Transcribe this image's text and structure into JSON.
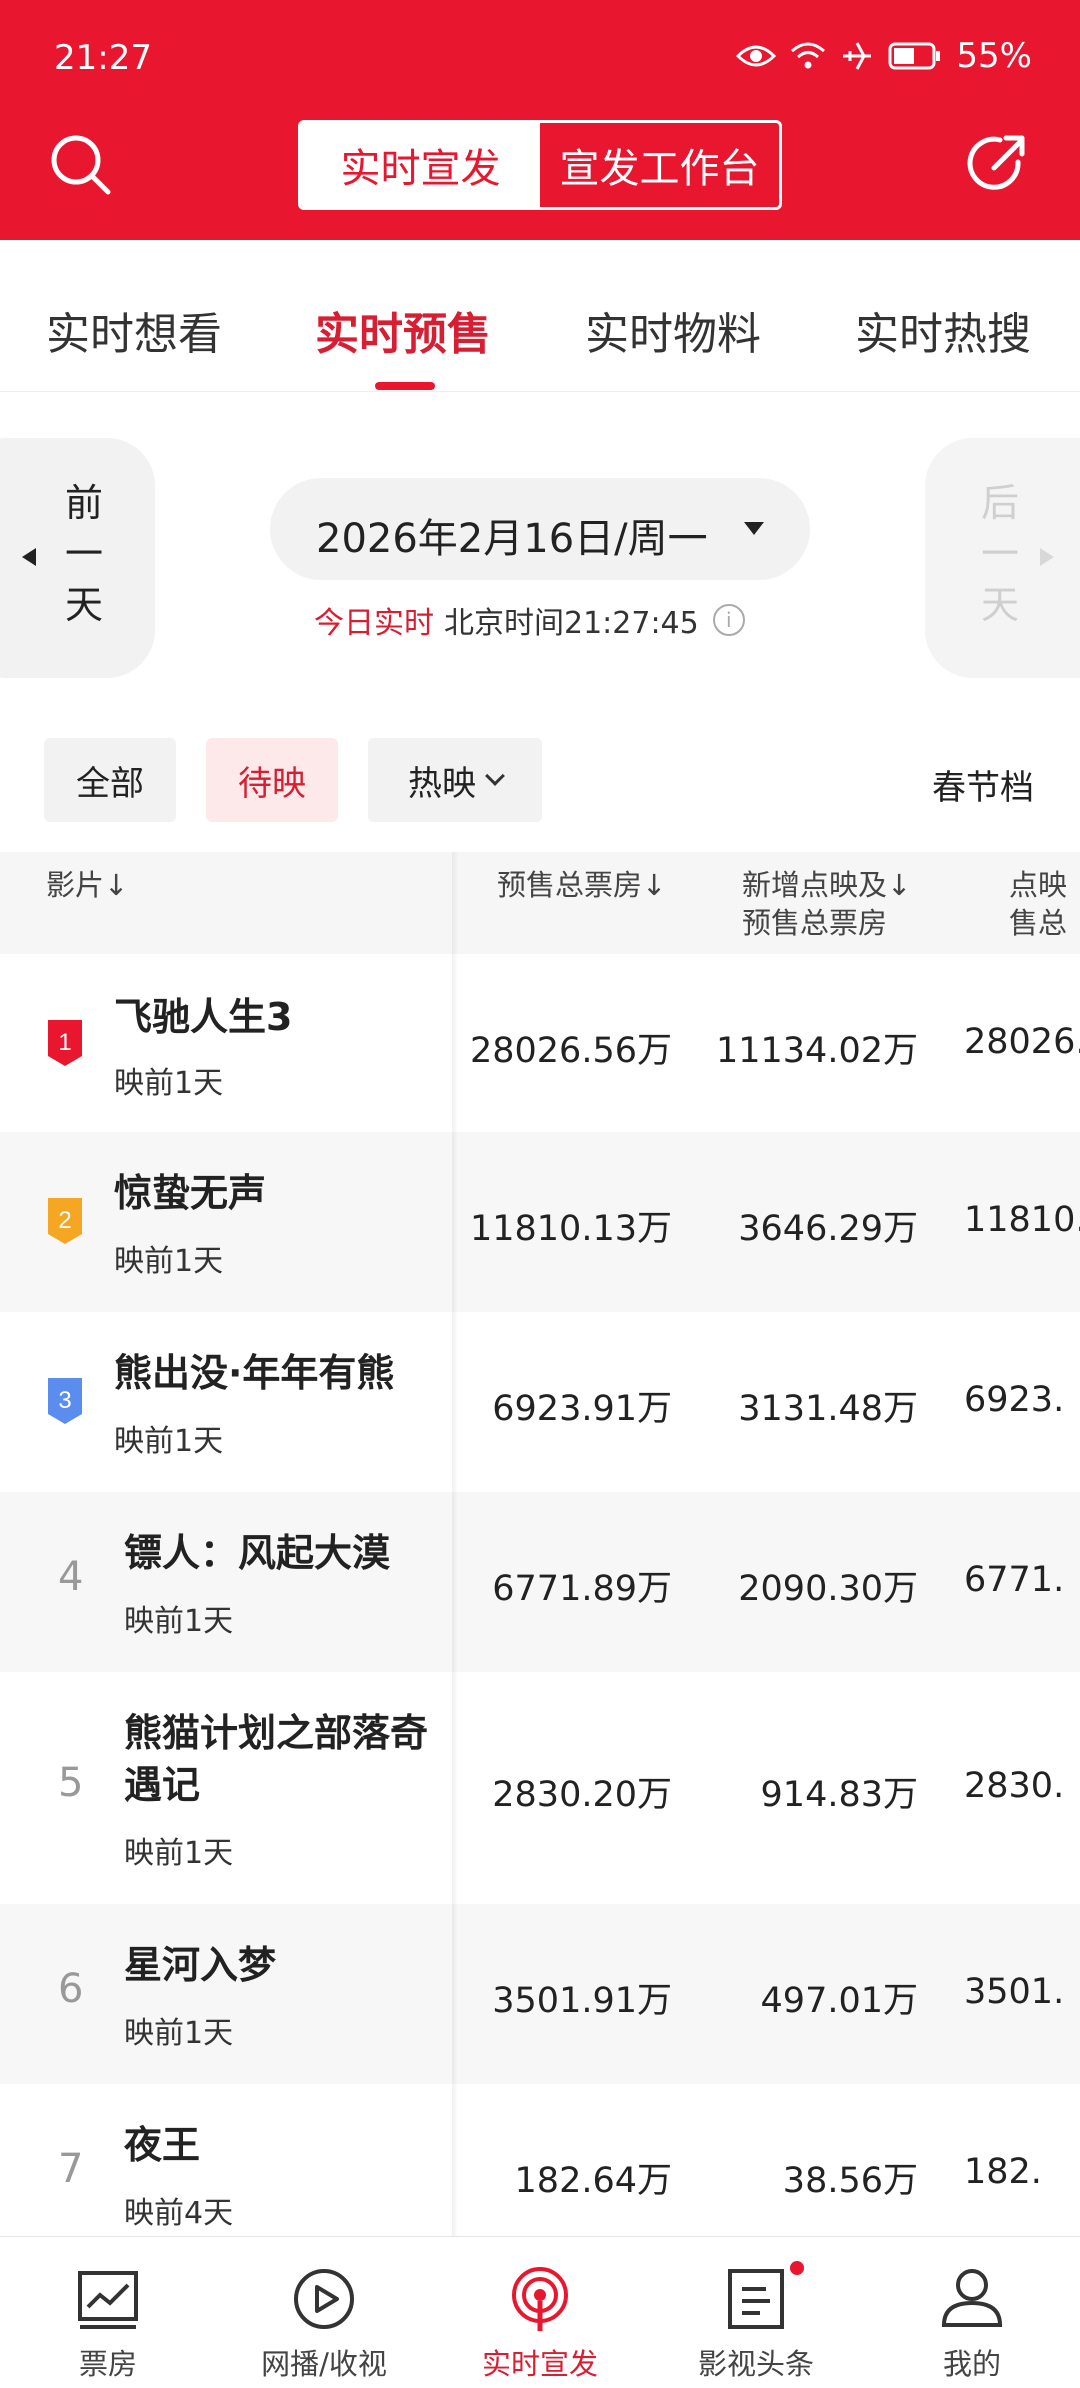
{
  "status_bar": {
    "time": "21:27",
    "battery": "55%"
  },
  "header": {
    "segments": [
      "实时宣发",
      "宣发工作台"
    ],
    "colors": {
      "brand_red": "#e8162f"
    }
  },
  "tabs": [
    "实时想看",
    "实时预售",
    "实时物料",
    "实时热搜"
  ],
  "date_nav": {
    "prev_label": "前一天",
    "next_label": "后一天",
    "date": "2026年2月16日/周一",
    "today_label": "今日实时",
    "beijing_time": "北京时间21:27:45"
  },
  "filters": {
    "all": "全部",
    "upcoming": "待映",
    "showing": "热映",
    "spring": "春节档"
  },
  "table": {
    "headers": {
      "film": "影片↓",
      "presale_total": "预售总票房↓",
      "new_line1": "新增点映及↓",
      "new_line2": "预售总票房",
      "col3_line1": "点映",
      "col3_line2": "售总"
    },
    "rows": [
      {
        "rank": "1",
        "title": "飞驰人生3",
        "status": "映前1天",
        "presale": "28026.56万",
        "new": "11134.02万",
        "col3": "28026."
      },
      {
        "rank": "2",
        "title": "惊蛰无声",
        "status": "映前1天",
        "presale": "11810.13万",
        "new": "3646.29万",
        "col3": "11810."
      },
      {
        "rank": "3",
        "title": "熊出没·年年有熊",
        "status": "映前1天",
        "presale": "6923.91万",
        "new": "3131.48万",
        "col3": "6923."
      },
      {
        "rank": "4",
        "title": "镖人：风起大漠",
        "status": "映前1天",
        "presale": "6771.89万",
        "new": "2090.30万",
        "col3": "6771."
      },
      {
        "rank": "5",
        "title_line1": "熊猫计划之部落奇",
        "title_line2": "遇记",
        "status": "映前1天",
        "presale": "2830.20万",
        "new": "914.83万",
        "col3": "2830."
      },
      {
        "rank": "6",
        "title": "星河入梦",
        "status": "映前1天",
        "presale": "3501.91万",
        "new": "497.01万",
        "col3": "3501."
      },
      {
        "rank": "7",
        "title": "夜王",
        "status": "映前4天",
        "presale": "182.64万",
        "new": "38.56万",
        "col3": "182."
      }
    ],
    "badge_colors": {
      "gold": "#e8162f",
      "silver": "#f5a623",
      "bronze": "#5b8def"
    }
  },
  "bottom_nav": [
    "票房",
    "网播/收视",
    "实时宣发",
    "影视头条",
    "我的"
  ]
}
